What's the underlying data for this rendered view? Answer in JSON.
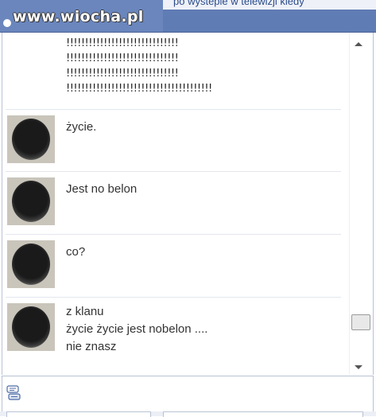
{
  "watermark": "www.wiocha.pl",
  "header_text": "po wystepie w telewizji kiedy",
  "exclamations": [
    "!!!!!!!!!!!!!!!!!!!!!!!!!!!!!!",
    "!!!!!!!!!!!!!!!!!!!!!!!!!!!!!!",
    "!!!!!!!!!!!!!!!!!!!!!!!!!!!!!!",
    "!!!!!!!!!!!!!!!!!!!!!!!!!!!!!!!!!!!!!!!"
  ],
  "messages": [
    {
      "lines": [
        "życie."
      ]
    },
    {
      "lines": [
        "Jest no belon"
      ]
    },
    {
      "lines": [
        "co?"
      ]
    },
    {
      "lines": [
        "z klanu",
        "życie życie jest nobelon ....",
        "nie znasz"
      ]
    }
  ],
  "colors": {
    "header": "#5f7cb4",
    "text": "#333333",
    "separator": "#e3e6ee"
  },
  "icons": {
    "scroll_up": "triangle-up",
    "scroll_down": "triangle-down",
    "composer": "speech-bubbles"
  }
}
